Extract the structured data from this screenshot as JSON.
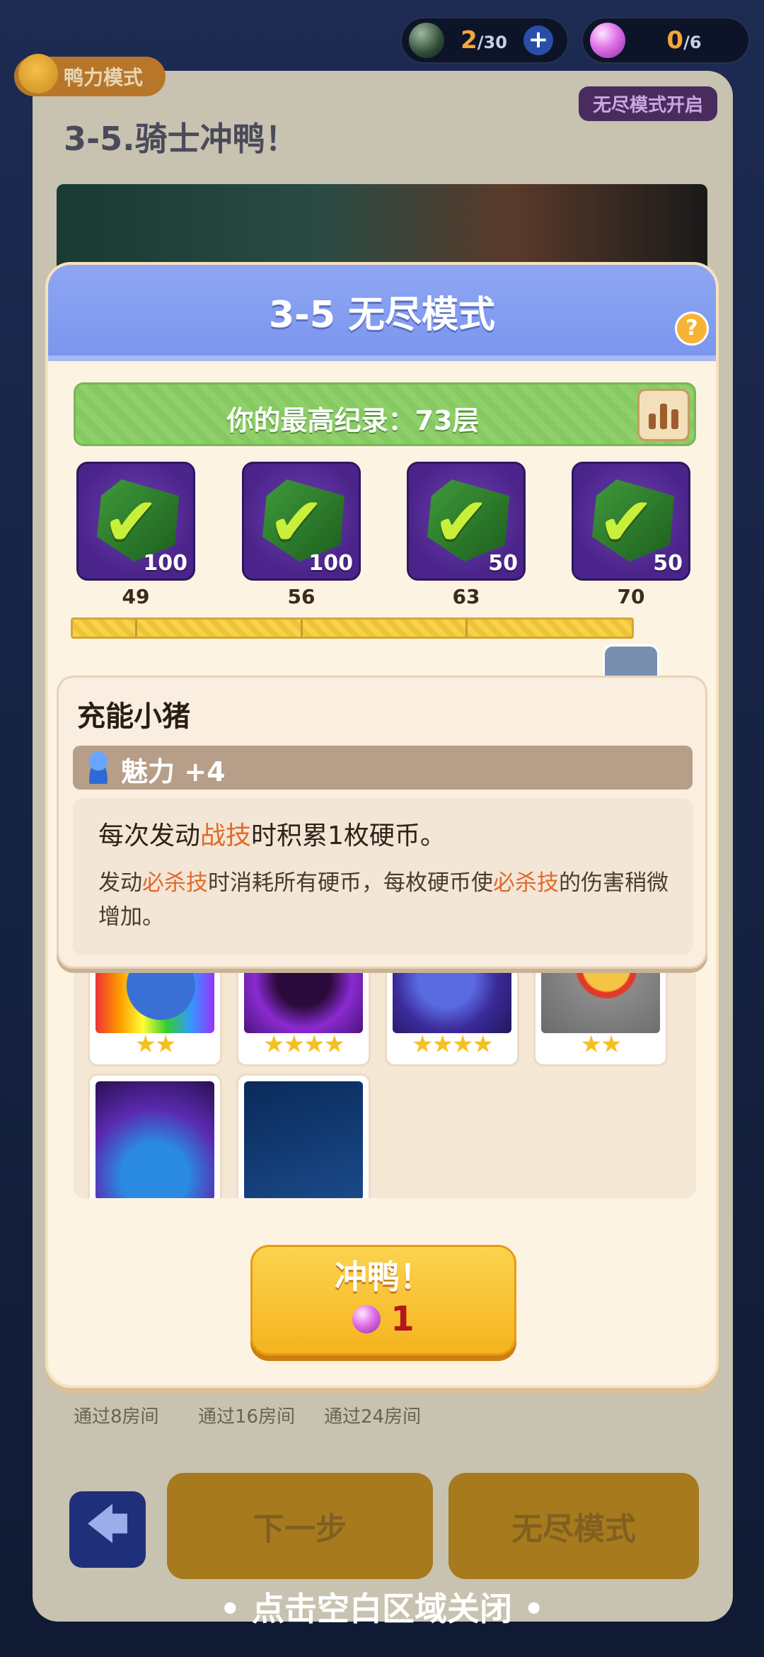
{
  "currency": {
    "energy": {
      "value": "2",
      "max": "/30",
      "icon": "dark-orb-icon"
    },
    "gems": {
      "value": "0",
      "max": "/6",
      "icon": "pink-orb-icon"
    },
    "add_label": "+"
  },
  "background": {
    "mode_badge": "鸭力模式",
    "endless_badge": "无尽模式开启",
    "level_title": "3-5.骑士冲鸭！",
    "milestones": [
      "通过8房间",
      "通过16房间",
      "通过24房间"
    ],
    "back_icon": "🡄",
    "next_button": "下一步",
    "endless_button": "无尽模式"
  },
  "modal": {
    "title": "3-5 无尽模式",
    "help_label": "?",
    "record": "你的最高纪录：73层",
    "rewards": [
      {
        "floor": "49",
        "amount": "100",
        "claimed": true
      },
      {
        "floor": "56",
        "amount": "100",
        "claimed": true
      },
      {
        "floor": "63",
        "amount": "50",
        "claimed": true
      },
      {
        "floor": "70",
        "amount": "50",
        "claimed": true
      }
    ],
    "check_glyph": "✔",
    "progress_fraction": 0.9
  },
  "tooltip": {
    "title": "充能小猪",
    "charm": "魅力 +4",
    "line1_a": "每次发动",
    "line1_hl": "战技",
    "line1_b": "时积累1枚硬币。",
    "line2_a": "发动",
    "line2_hl1": "必杀技",
    "line2_b": "时消耗所有硬币，每枚硬币使",
    "line2_hl2": "必杀技",
    "line2_c": "的伤害稍微增加。"
  },
  "cards": [
    {
      "stars": "★★",
      "art": "piggy-bank"
    },
    {
      "stars": "★★★★",
      "art": "ghost-face"
    },
    {
      "stars": "★★★★",
      "art": "blob-creature"
    },
    {
      "stars": "★★",
      "art": "fire-ring"
    },
    {
      "stars": "",
      "art": "swirl"
    },
    {
      "stars": "",
      "art": "laser-lines"
    }
  ],
  "go_button": {
    "label": "冲鸭！",
    "cost": "1"
  },
  "close_hint": "• 点击空白区域关闭 •",
  "colors": {
    "accent_blue": "#7b96ee",
    "record_green": "#8fd06a",
    "go_yellow": "#f6b31f",
    "highlight": "#e06a2a"
  }
}
